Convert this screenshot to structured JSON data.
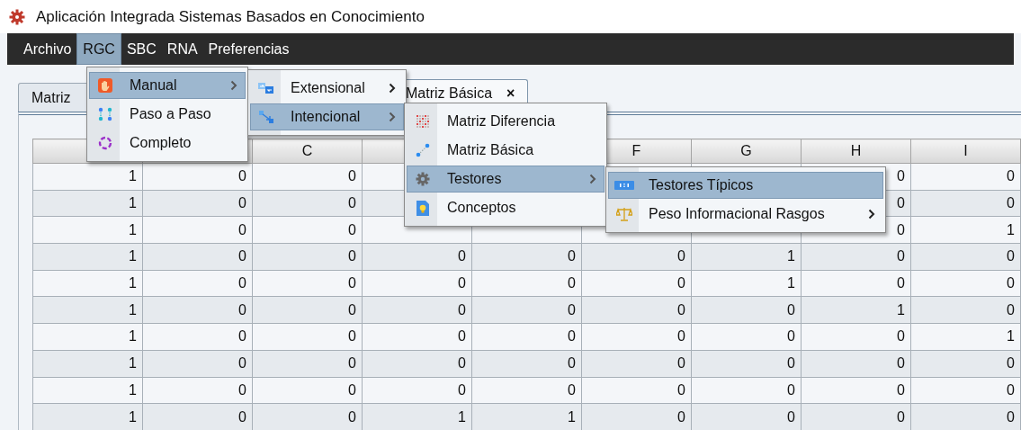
{
  "window": {
    "title": "Aplicación Integrada Sistemas Basados en Conocimiento"
  },
  "menubar": [
    {
      "label": "Archivo",
      "selected": false
    },
    {
      "label": "RGC",
      "selected": true
    },
    {
      "label": "SBC",
      "selected": false
    },
    {
      "label": "RNA",
      "selected": false
    },
    {
      "label": "Preferencias",
      "selected": false
    }
  ],
  "tabs": [
    {
      "label": "Matriz",
      "selected": false
    },
    {
      "label": "Matriz Básica",
      "selected": true,
      "close": "×"
    }
  ],
  "table": {
    "columns": [
      null,
      null,
      "C",
      null,
      null,
      "F",
      "G",
      "H",
      "I"
    ],
    "rows": [
      [
        "1",
        "0",
        "0",
        null,
        null,
        null,
        null,
        "0",
        "0"
      ],
      [
        "1",
        "0",
        "0",
        null,
        null,
        null,
        null,
        "0",
        "0"
      ],
      [
        "1",
        "0",
        "0",
        null,
        null,
        null,
        null,
        "0",
        "1"
      ],
      [
        "1",
        "0",
        "0",
        "0",
        "0",
        "0",
        "1",
        "0",
        "0"
      ],
      [
        "1",
        "0",
        "0",
        "0",
        "0",
        "0",
        "1",
        "0",
        "0"
      ],
      [
        "1",
        "0",
        "0",
        "0",
        "0",
        "0",
        "0",
        "1",
        "0"
      ],
      [
        "1",
        "0",
        "0",
        "0",
        "0",
        "0",
        "0",
        "0",
        "1"
      ],
      [
        "1",
        "0",
        "0",
        "0",
        "0",
        "0",
        "0",
        "0",
        "0"
      ],
      [
        "1",
        "0",
        "0",
        "0",
        "0",
        "0",
        "0",
        "0",
        "0"
      ],
      [
        "1",
        "0",
        "0",
        "1",
        "1",
        "0",
        "0",
        "0",
        "0"
      ]
    ]
  },
  "menus": [
    {
      "items": [
        {
          "label": "Manual",
          "selected": true,
          "submenu": true
        },
        {
          "label": "Paso a Paso",
          "selected": false,
          "submenu": false
        },
        {
          "label": "Completo",
          "selected": false,
          "submenu": false
        }
      ]
    },
    {
      "items": [
        {
          "label": "Extensional",
          "selected": false,
          "submenu": true
        },
        {
          "label": "Intencional",
          "selected": true,
          "submenu": true
        }
      ]
    },
    {
      "items": [
        {
          "label": "Matriz Diferencia",
          "selected": false,
          "submenu": false
        },
        {
          "label": "Matriz Básica",
          "selected": false,
          "submenu": false
        },
        {
          "label": "Testores",
          "selected": true,
          "submenu": true
        },
        {
          "label": "Conceptos",
          "selected": false,
          "submenu": false
        }
      ]
    },
    {
      "items": [
        {
          "label": "Testores Típicos",
          "selected": true,
          "submenu": false
        },
        {
          "label": "Peso Informacional Rasgos",
          "selected": false,
          "submenu": true
        }
      ]
    }
  ]
}
